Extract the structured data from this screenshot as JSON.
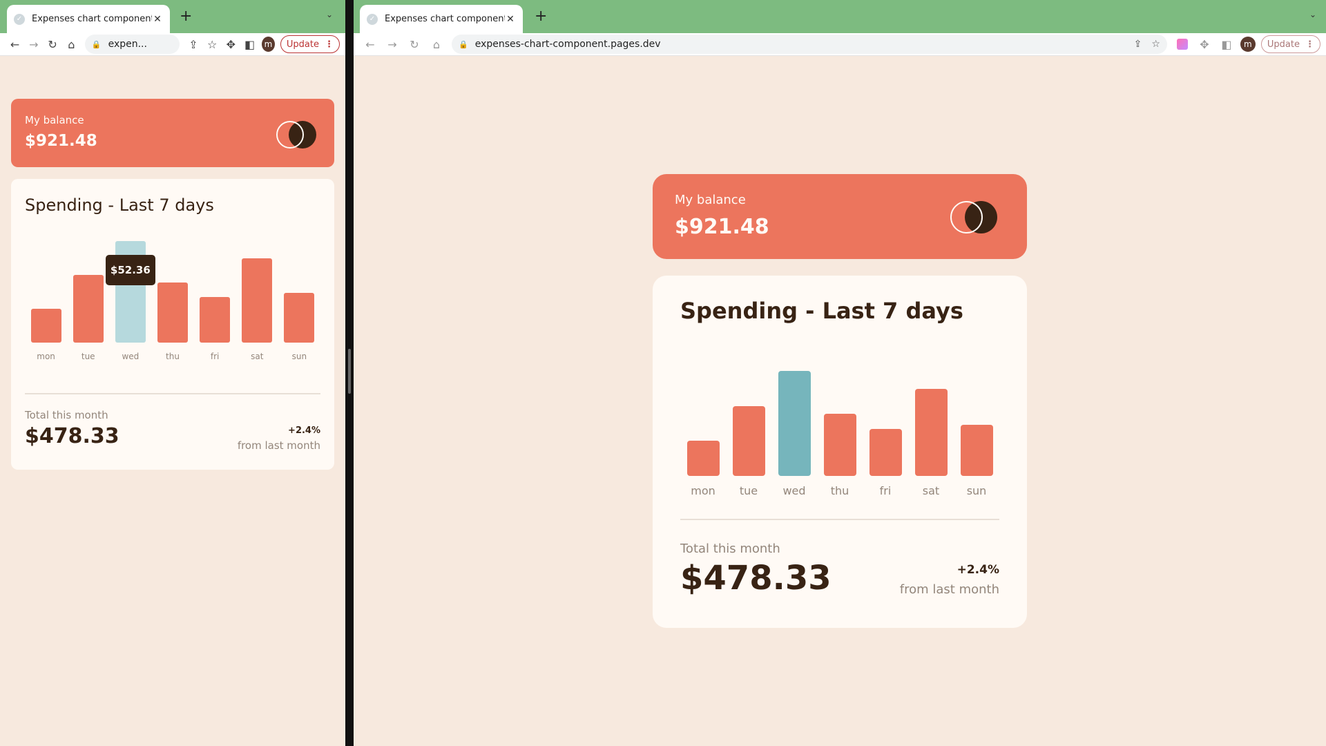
{
  "browser": {
    "tab_title": "Expenses chart component",
    "url_full": "expenses-chart-component.pages.dev",
    "url_short": "expen...",
    "update_label": "Update",
    "avatar_letter": "m",
    "new_tab": "+",
    "tab_close": "✕",
    "tab_menu": "⌄"
  },
  "app": {
    "balance_label": "My balance",
    "balance_amount": "$921.48",
    "spending_title": "Spending - Last 7 days",
    "total_label": "Total this month",
    "total_amount": "$478.33",
    "change_percent": "+2.4%",
    "change_label": "from last month"
  },
  "colors": {
    "accent": "#ec755d",
    "today": "#76b5bc",
    "hover": "#b6d9dd",
    "dark": "#382314",
    "card": "#fffaf5",
    "page": "#f7e9de",
    "chrome": "#7dbb80"
  },
  "chart_data": [
    {
      "type": "bar",
      "categories": [
        "mon",
        "tue",
        "wed",
        "thu",
        "fri",
        "sat",
        "sun"
      ],
      "values": [
        17.45,
        34.91,
        52.36,
        31.07,
        23.39,
        43.28,
        25.48
      ],
      "highlight": "wed",
      "tooltip": "$52.36",
      "view": "mobile"
    },
    {
      "type": "bar",
      "categories": [
        "mon",
        "tue",
        "wed",
        "thu",
        "fri",
        "sat",
        "sun"
      ],
      "values": [
        17.45,
        34.91,
        52.36,
        31.07,
        23.39,
        43.28,
        25.48
      ],
      "highlight": "wed",
      "view": "desktop"
    }
  ]
}
